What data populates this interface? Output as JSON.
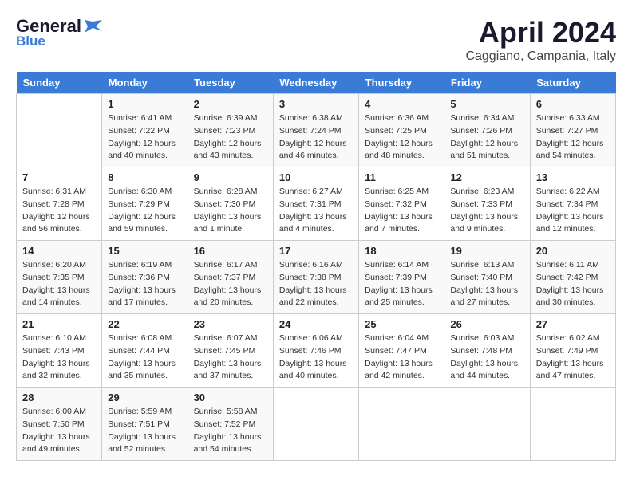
{
  "header": {
    "logo_general": "General",
    "logo_blue": "Blue",
    "title": "April 2024",
    "subtitle": "Caggiano, Campania, Italy"
  },
  "calendar": {
    "days_of_week": [
      "Sunday",
      "Monday",
      "Tuesday",
      "Wednesday",
      "Thursday",
      "Friday",
      "Saturday"
    ],
    "weeks": [
      [
        {
          "date": "",
          "sunrise": "",
          "sunset": "",
          "daylight": ""
        },
        {
          "date": "1",
          "sunrise": "6:41 AM",
          "sunset": "7:22 PM",
          "daylight": "12 hours and 40 minutes."
        },
        {
          "date": "2",
          "sunrise": "6:39 AM",
          "sunset": "7:23 PM",
          "daylight": "12 hours and 43 minutes."
        },
        {
          "date": "3",
          "sunrise": "6:38 AM",
          "sunset": "7:24 PM",
          "daylight": "12 hours and 46 minutes."
        },
        {
          "date": "4",
          "sunrise": "6:36 AM",
          "sunset": "7:25 PM",
          "daylight": "12 hours and 48 minutes."
        },
        {
          "date": "5",
          "sunrise": "6:34 AM",
          "sunset": "7:26 PM",
          "daylight": "12 hours and 51 minutes."
        },
        {
          "date": "6",
          "sunrise": "6:33 AM",
          "sunset": "7:27 PM",
          "daylight": "12 hours and 54 minutes."
        }
      ],
      [
        {
          "date": "7",
          "sunrise": "6:31 AM",
          "sunset": "7:28 PM",
          "daylight": "12 hours and 56 minutes."
        },
        {
          "date": "8",
          "sunrise": "6:30 AM",
          "sunset": "7:29 PM",
          "daylight": "12 hours and 59 minutes."
        },
        {
          "date": "9",
          "sunrise": "6:28 AM",
          "sunset": "7:30 PM",
          "daylight": "13 hours and 1 minute."
        },
        {
          "date": "10",
          "sunrise": "6:27 AM",
          "sunset": "7:31 PM",
          "daylight": "13 hours and 4 minutes."
        },
        {
          "date": "11",
          "sunrise": "6:25 AM",
          "sunset": "7:32 PM",
          "daylight": "13 hours and 7 minutes."
        },
        {
          "date": "12",
          "sunrise": "6:23 AM",
          "sunset": "7:33 PM",
          "daylight": "13 hours and 9 minutes."
        },
        {
          "date": "13",
          "sunrise": "6:22 AM",
          "sunset": "7:34 PM",
          "daylight": "13 hours and 12 minutes."
        }
      ],
      [
        {
          "date": "14",
          "sunrise": "6:20 AM",
          "sunset": "7:35 PM",
          "daylight": "13 hours and 14 minutes."
        },
        {
          "date": "15",
          "sunrise": "6:19 AM",
          "sunset": "7:36 PM",
          "daylight": "13 hours and 17 minutes."
        },
        {
          "date": "16",
          "sunrise": "6:17 AM",
          "sunset": "7:37 PM",
          "daylight": "13 hours and 20 minutes."
        },
        {
          "date": "17",
          "sunrise": "6:16 AM",
          "sunset": "7:38 PM",
          "daylight": "13 hours and 22 minutes."
        },
        {
          "date": "18",
          "sunrise": "6:14 AM",
          "sunset": "7:39 PM",
          "daylight": "13 hours and 25 minutes."
        },
        {
          "date": "19",
          "sunrise": "6:13 AM",
          "sunset": "7:40 PM",
          "daylight": "13 hours and 27 minutes."
        },
        {
          "date": "20",
          "sunrise": "6:11 AM",
          "sunset": "7:42 PM",
          "daylight": "13 hours and 30 minutes."
        }
      ],
      [
        {
          "date": "21",
          "sunrise": "6:10 AM",
          "sunset": "7:43 PM",
          "daylight": "13 hours and 32 minutes."
        },
        {
          "date": "22",
          "sunrise": "6:08 AM",
          "sunset": "7:44 PM",
          "daylight": "13 hours and 35 minutes."
        },
        {
          "date": "23",
          "sunrise": "6:07 AM",
          "sunset": "7:45 PM",
          "daylight": "13 hours and 37 minutes."
        },
        {
          "date": "24",
          "sunrise": "6:06 AM",
          "sunset": "7:46 PM",
          "daylight": "13 hours and 40 minutes."
        },
        {
          "date": "25",
          "sunrise": "6:04 AM",
          "sunset": "7:47 PM",
          "daylight": "13 hours and 42 minutes."
        },
        {
          "date": "26",
          "sunrise": "6:03 AM",
          "sunset": "7:48 PM",
          "daylight": "13 hours and 44 minutes."
        },
        {
          "date": "27",
          "sunrise": "6:02 AM",
          "sunset": "7:49 PM",
          "daylight": "13 hours and 47 minutes."
        }
      ],
      [
        {
          "date": "28",
          "sunrise": "6:00 AM",
          "sunset": "7:50 PM",
          "daylight": "13 hours and 49 minutes."
        },
        {
          "date": "29",
          "sunrise": "5:59 AM",
          "sunset": "7:51 PM",
          "daylight": "13 hours and 52 minutes."
        },
        {
          "date": "30",
          "sunrise": "5:58 AM",
          "sunset": "7:52 PM",
          "daylight": "13 hours and 54 minutes."
        },
        {
          "date": "",
          "sunrise": "",
          "sunset": "",
          "daylight": ""
        },
        {
          "date": "",
          "sunrise": "",
          "sunset": "",
          "daylight": ""
        },
        {
          "date": "",
          "sunrise": "",
          "sunset": "",
          "daylight": ""
        },
        {
          "date": "",
          "sunrise": "",
          "sunset": "",
          "daylight": ""
        }
      ]
    ]
  }
}
